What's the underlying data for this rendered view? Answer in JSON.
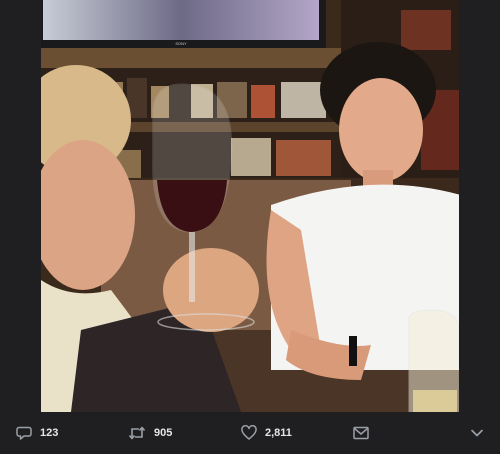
{
  "photo": {
    "alt": "",
    "tv_brand": "SONY"
  },
  "actions": {
    "reply_count": "123",
    "retweet_count": "905",
    "like_count": "2,811"
  },
  "icons": {
    "reply": "reply-icon",
    "retweet": "retweet-icon",
    "like": "heart-icon",
    "dm": "envelope-icon",
    "more": "chevron-down-icon"
  },
  "colors": {
    "background": "#1f1f21",
    "icon": "#9aa0a8",
    "count_text": "#e6e6ea"
  }
}
